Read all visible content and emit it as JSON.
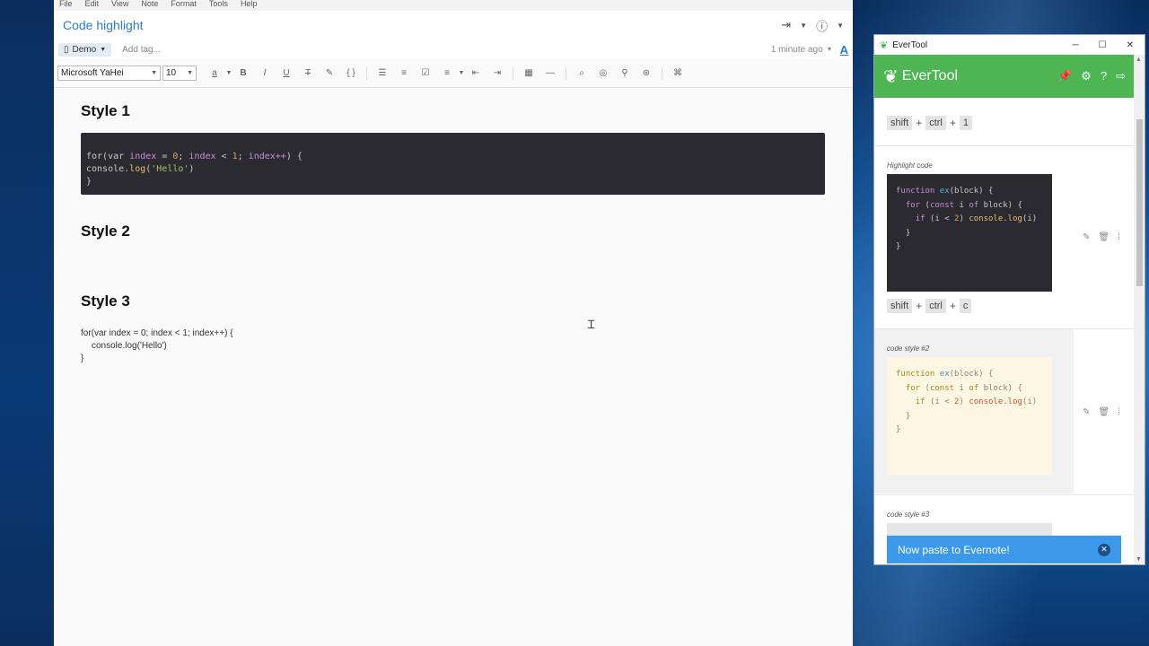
{
  "evernote": {
    "menu": [
      "File",
      "Edit",
      "View",
      "Note",
      "Format",
      "Tools",
      "Help"
    ],
    "note_title": "Code highlight",
    "notebook": "Demo",
    "add_tag_placeholder": "Add tag...",
    "updated": "1 minute ago",
    "font_family": "Microsoft YaHei",
    "font_size": "10",
    "headings": {
      "style1": "Style 1",
      "style2": "Style 2",
      "style3": "Style 3"
    },
    "code1": {
      "line1_a": "for(var ",
      "line1_b": "index",
      "line1_c": " = ",
      "line1_d": "0",
      "line1_e": "; ",
      "line1_f": "index",
      "line1_g": " < ",
      "line1_h": "1",
      "line1_i": "; ",
      "line1_j": "index++",
      "line1_k": ") {",
      "line2_a": "console.",
      "line2_b": "log",
      "line2_c": "(",
      "line2_d": "'Hello'",
      "line2_e": ")",
      "line3": "}"
    },
    "code3": {
      "line1": "for(var index = 0; index < 1; index++) {",
      "line2": "console.log('Hello')",
      "line3": "}"
    }
  },
  "evertool": {
    "window_title": "EverTool",
    "brand": "EverTool",
    "shortcut1": {
      "k1": "shift",
      "k2": "ctrl",
      "k3": "1"
    },
    "section1_label": "Highlight code",
    "shortcut2": {
      "k1": "shift",
      "k2": "ctrl",
      "k3": "c"
    },
    "section2_label": "code style #2",
    "section3_label": "code style #3",
    "plus": "+",
    "code_sample": {
      "fn_kw": "function",
      "fn_name": "ex",
      "fn_args": "(block) {",
      "for_kw": "for",
      "for_open": " (",
      "const_kw": "const",
      "for_var": " i ",
      "of_kw": "of",
      "for_rest": " block) {",
      "if_kw": "if",
      "if_cond_a": " (i < ",
      "if_num": "2",
      "if_cond_b": ") ",
      "log_call": "console.log",
      "log_args": "(i)",
      "close_inner": "}",
      "close_outer": "}"
    },
    "toast": "Now paste to Evernote!"
  }
}
